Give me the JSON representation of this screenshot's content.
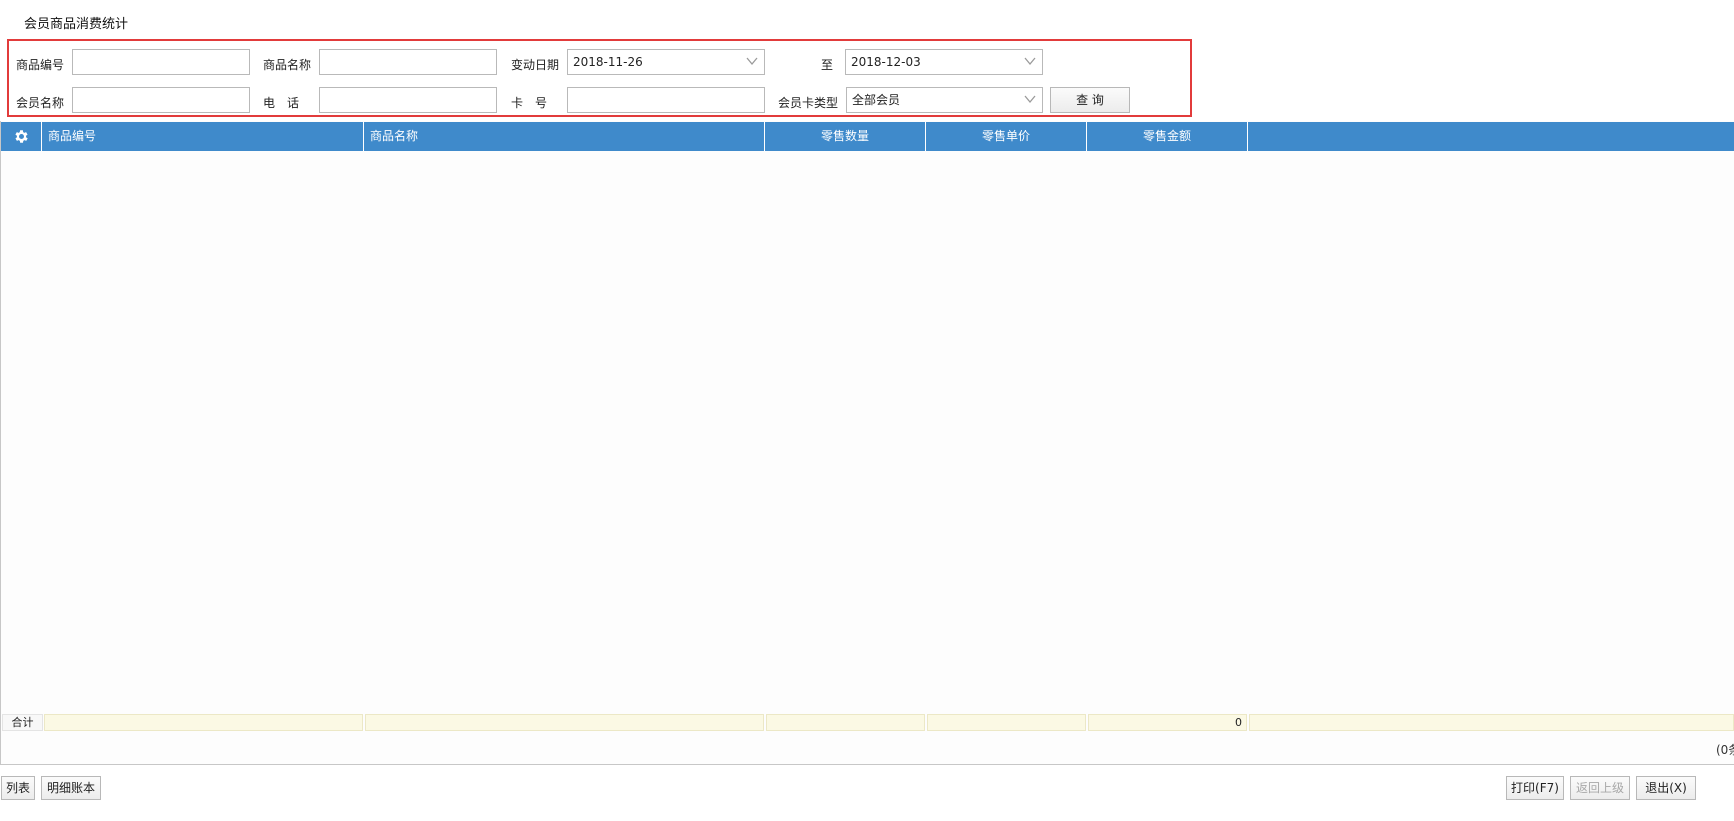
{
  "page": {
    "title": "会员商品消费统计"
  },
  "filters": {
    "product_code_label": "商品编号",
    "product_code_value": "",
    "product_name_label": "商品名称",
    "product_name_value": "",
    "date_label": "变动日期",
    "date_from": "2018-11-26",
    "to_label": "至",
    "date_to": "2018-12-03",
    "member_name_label": "会员名称",
    "member_name_value": "",
    "phone_label": "电　话",
    "phone_value": "",
    "card_label": "卡　号",
    "card_value": "",
    "card_type_label": "会员卡类型",
    "card_type_value": "全部会员",
    "query_label": "查 询"
  },
  "table": {
    "settings_icon": "gear-icon",
    "columns": [
      "商品编号",
      "商品名称",
      "零售数量",
      "零售单价",
      "零售金额"
    ],
    "rows": [],
    "summary_label": "合计",
    "summary_amount": "0",
    "pager_fragment": "(0条"
  },
  "footer": {
    "list_label": "列表",
    "detail_label": "明细账本",
    "print_label": "打印(F7)",
    "back_label": "返回上级",
    "exit_label": "退出(X)"
  },
  "colors": {
    "header_bg": "#3f8acb",
    "filter_border": "#e23b3b",
    "summary_bg": "#fbf9e4"
  }
}
